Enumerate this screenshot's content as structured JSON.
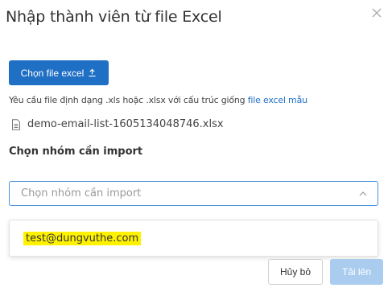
{
  "dialog": {
    "title": "Nhập thành viên từ file Excel",
    "close_icon": "close-icon"
  },
  "upload": {
    "button_label": "Chọn file excel",
    "button_icon": "upload-icon",
    "hint_text": "Yêu cầu file định dạng .xls hoặc .xlsx với cấu trúc giống",
    "hint_link": "file excel mẫu"
  },
  "file": {
    "icon": "file-icon",
    "name": "demo-email-list-1605134048746.xlsx"
  },
  "group": {
    "label": "Chọn nhóm cần import",
    "placeholder": "Chọn nhóm cần import",
    "chevron_icon": "chevron-up-icon",
    "options": [
      "test@dungvuthe.com"
    ]
  },
  "footer": {
    "cancel_label": "Hủy bỏ",
    "upload_label": "Tải lên"
  },
  "colors": {
    "primary": "#1f6fc5",
    "primary_disabled": "#a9ccef",
    "highlight": "#fff200"
  }
}
